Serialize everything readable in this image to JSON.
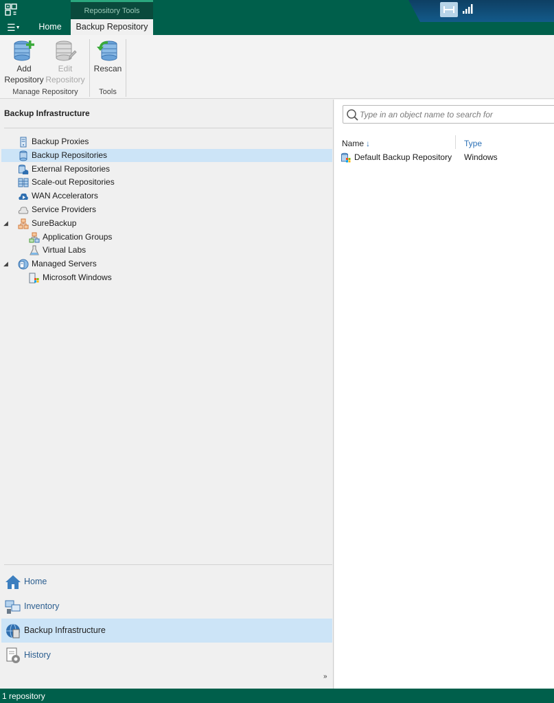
{
  "titlebar": {
    "context_tab_header": "Repository Tools",
    "tabs": [
      "Home",
      "Backup Repository"
    ]
  },
  "ribbon": {
    "add_repository": [
      "Add",
      "Repository"
    ],
    "edit_repository": [
      "Edit",
      "Repository"
    ],
    "rescan": "Rescan",
    "group_manage": "Manage Repository",
    "group_tools": "Tools"
  },
  "left_panel": {
    "title": "Backup Infrastructure",
    "tree": [
      {
        "label": "Backup Proxies",
        "icon": "server-icon"
      },
      {
        "label": "Backup Repositories",
        "icon": "database-icon",
        "selected": true
      },
      {
        "label": "External Repositories",
        "icon": "cloud-database-icon"
      },
      {
        "label": "Scale-out Repositories",
        "icon": "scaleout-repository-icon"
      },
      {
        "label": "WAN Accelerators",
        "icon": "wan-accelerator-icon"
      },
      {
        "label": "Service Providers",
        "icon": "cloud-provider-icon"
      },
      {
        "label": "SureBackup",
        "icon": "surebackup-icon",
        "expanded": true
      },
      {
        "label": "Application Groups",
        "icon": "application-groups-icon"
      },
      {
        "label": "Virtual Labs",
        "icon": "virtual-labs-icon"
      },
      {
        "label": "Managed Servers",
        "icon": "managed-servers-icon",
        "expanded": true
      },
      {
        "label": "Microsoft Windows",
        "icon": "windows-server-icon"
      }
    ],
    "nav": [
      {
        "label": "Home",
        "icon": "home-icon"
      },
      {
        "label": "Inventory",
        "icon": "inventory-icon"
      },
      {
        "label": "Backup Infrastructure",
        "icon": "backup-infrastructure-icon",
        "selected": true
      },
      {
        "label": "History",
        "icon": "history-icon"
      }
    ]
  },
  "right_panel": {
    "search_placeholder": "Type in an object name to search for",
    "columns": {
      "name": "Name",
      "type": "Type"
    },
    "rows": [
      {
        "name": "Default Backup Repository",
        "type": "Windows"
      }
    ]
  },
  "statusbar": {
    "text": "1 repository"
  },
  "colors": {
    "brand_green": "#005f4b",
    "selection": "#cce4f7",
    "link_blue": "#2a6fb5"
  }
}
